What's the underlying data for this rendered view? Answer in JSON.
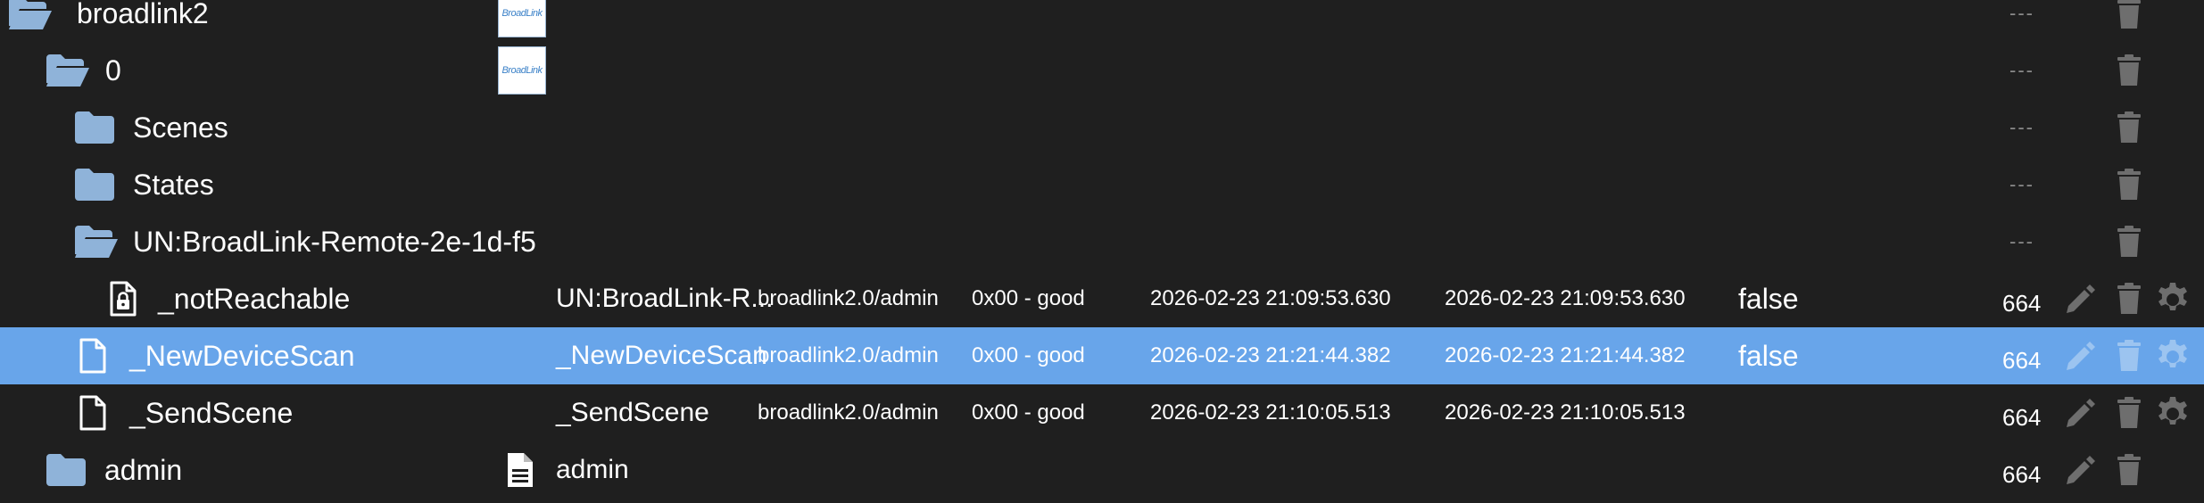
{
  "colors": {
    "background": "#1f1f1f",
    "selected_row": "#68a5ea",
    "folder_icon": "#8fb3d9",
    "action_icon": "#6e6e6e",
    "action_icon_selected": "#9cc4f0"
  },
  "rows": [
    {
      "name": "broadlink2",
      "icon": "folder-open-icon",
      "thumb": "BroadLink",
      "dash": "---"
    },
    {
      "name": "0",
      "icon": "folder-open-icon",
      "thumb": "BroadLink",
      "dash": "---"
    },
    {
      "name": "Scenes",
      "icon": "folder-icon",
      "dash": "---"
    },
    {
      "name": "States",
      "icon": "folder-icon",
      "dash": "---"
    },
    {
      "name": "UN:BroadLink-Remote-2e-1d-f5",
      "icon": "folder-open-icon",
      "dash": "---"
    },
    {
      "name": "_notReachable",
      "icon": "file-lock-icon",
      "display_name": "UN:BroadLink-R...",
      "role": "broadlink2.0/admin",
      "status": "0x00 - good",
      "timestamp": "2026-02-23 21:09:53.630",
      "last_change": "2026-02-23 21:09:53.630",
      "value": "false",
      "acl": "664"
    },
    {
      "name": "_NewDeviceScan",
      "icon": "file-icon",
      "display_name": "_NewDeviceScan",
      "role": "broadlink2.0/admin",
      "status": "0x00 - good",
      "timestamp": "2026-02-23 21:21:44.382",
      "last_change": "2026-02-23 21:21:44.382",
      "value": "false",
      "acl": "664",
      "selected": true
    },
    {
      "name": "_SendScene",
      "icon": "file-icon",
      "display_name": "_SendScene",
      "role": "broadlink2.0/admin",
      "status": "0x00 - good",
      "timestamp": "2026-02-23 21:10:05.513",
      "last_change": "2026-02-23 21:10:05.513",
      "value": "",
      "acl": "664"
    },
    {
      "name": "admin",
      "icon": "folder-icon",
      "display_name": "admin",
      "acl": "664"
    }
  ]
}
